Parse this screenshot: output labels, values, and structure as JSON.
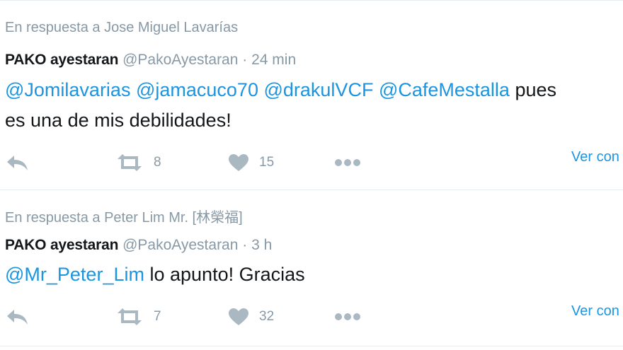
{
  "tweets": [
    {
      "context": "En respuesta a Jose Miguel Lavarías",
      "name": "PAKO ayestaran",
      "handle": "@PakoAyestaran",
      "separator": "·",
      "time": "24 min",
      "mentions": [
        "@Jomilavarias",
        "@jamacuco70",
        "@drakulVCF",
        "@CafeMestalla"
      ],
      "text_after": "pues",
      "text_line2": "es una de mis debilidades!",
      "retweets": "8",
      "likes": "15",
      "more_link": "Ver con"
    },
    {
      "context": "En respuesta a Peter Lim Mr. [林榮福]",
      "name": "PAKO ayestaran",
      "handle": "@PakoAyestaran",
      "separator": "·",
      "time": "3 h",
      "mentions": [
        "@Mr_Peter_Lim"
      ],
      "text_after": "lo apunto! Gracias",
      "retweets": "7",
      "likes": "32",
      "more_link": "Ver con"
    }
  ],
  "icons": [
    "reply-icon",
    "retweet-icon",
    "like-icon",
    "more-icon"
  ],
  "colors": {
    "mention": "#1b95e0",
    "muted": "#8899a6",
    "icon": "#aab8c2",
    "text": "#14171a"
  }
}
